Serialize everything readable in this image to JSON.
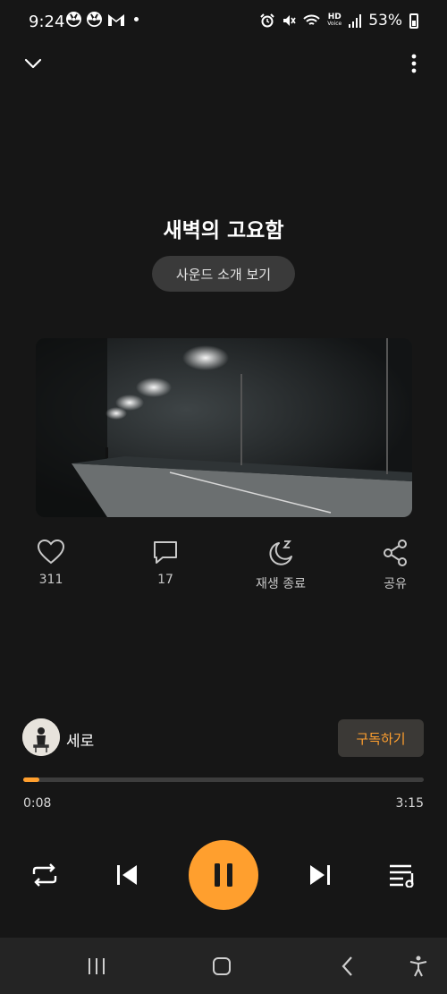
{
  "status": {
    "time": "9:24",
    "battery_percent": "53%",
    "hd_label": "HD",
    "voice_label": "Voice"
  },
  "header": {
    "collapse_icon": "chevron-down-icon",
    "more_icon": "more-vertical-icon"
  },
  "track": {
    "title": "새벽의 고요함",
    "intro_button": "사운드 소개 보기"
  },
  "actions": [
    {
      "icon": "heart-icon",
      "label": "311"
    },
    {
      "icon": "comment-icon",
      "label": "17"
    },
    {
      "icon": "sleep-timer-icon",
      "label": "재생 종료"
    },
    {
      "icon": "share-icon",
      "label": "공유"
    }
  ],
  "artist": {
    "name": "세로",
    "subscribe_label": "구독하기"
  },
  "playback": {
    "current_time": "0:08",
    "total_time": "3:15",
    "progress_fraction": 0.041,
    "is_playing": true
  },
  "colors": {
    "accent": "#ff9f2e",
    "background": "#161616"
  }
}
